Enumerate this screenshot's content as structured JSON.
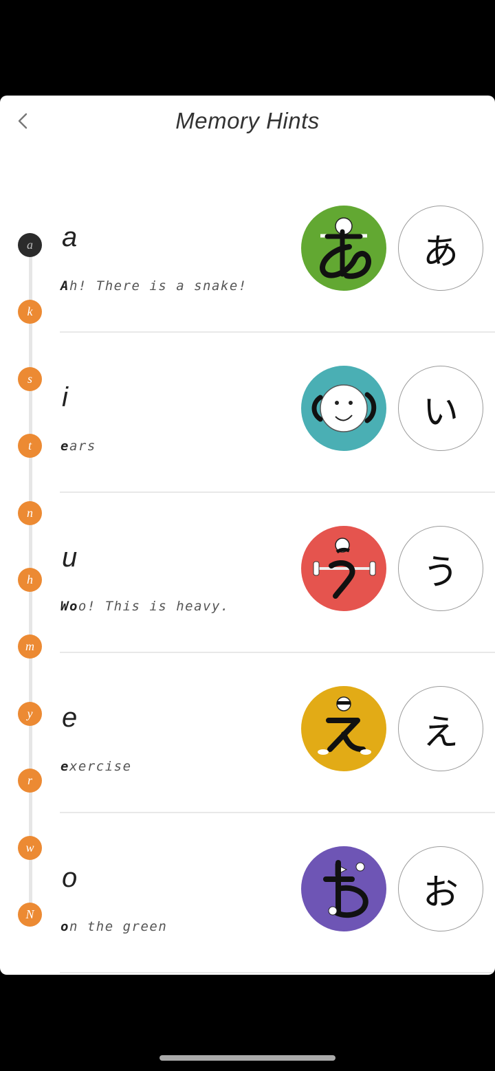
{
  "header": {
    "title": "Memory Hints",
    "back_icon": "chevron-left-icon"
  },
  "rail": {
    "items": [
      "a",
      "k",
      "s",
      "t",
      "n",
      "h",
      "m",
      "y",
      "r",
      "w",
      "N"
    ],
    "active": "a",
    "colors": {
      "active": "#2b2b2b",
      "inactive": "#ec8a33"
    }
  },
  "rows": [
    {
      "latin": "a",
      "hint_bold": "A",
      "hint_rest": "h! There is a snake!",
      "kana": "あ",
      "color": "#62a832",
      "picture": "man-with-snake"
    },
    {
      "latin": "i",
      "hint_bold": "e",
      "hint_rest": "ars",
      "kana": "い",
      "color": "#4aafb4",
      "picture": "face-with-ears"
    },
    {
      "latin": "u",
      "hint_bold": "Wo",
      "hint_rest": "o! This is heavy.",
      "kana": "う",
      "color": "#e5544e",
      "picture": "man-lifting-barbell"
    },
    {
      "latin": "e",
      "hint_bold": "e",
      "hint_rest": "xercise",
      "kana": "え",
      "color": "#e2ab16",
      "picture": "man-exercising"
    },
    {
      "latin": "o",
      "hint_bold": "o",
      "hint_rest": "n the green",
      "kana": "お",
      "color": "#6e55b5",
      "picture": "golf-flag"
    }
  ]
}
